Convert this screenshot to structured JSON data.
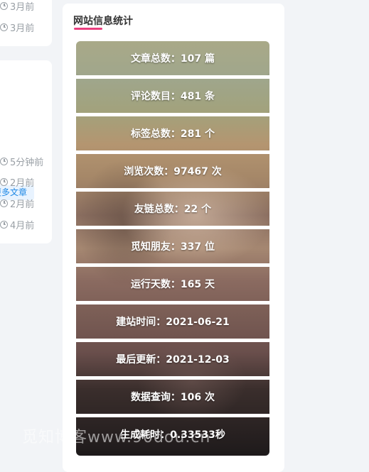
{
  "left_column": {
    "top_card": {
      "times": [
        "3月前",
        "3月前"
      ]
    },
    "middle_card": {
      "more_articles_label": "更多文章",
      "times": [
        "5分钟前",
        "2月前",
        "2月前",
        "4月前"
      ]
    }
  },
  "stats_widget": {
    "title": "网站信息统计",
    "accent_color": "#ea3e7e",
    "items": [
      "文章总数：107 篇",
      "评论数目：481 条",
      "标签总数：281 个",
      "浏览次数：97467 次",
      "友链总数：22 个",
      "觅知朋友：337 位",
      "运行天数：165 天",
      "建站时间：2021-06-21",
      "最后更新：2021-12-03",
      "数据查询：106 次",
      "生成耗时：0.33533秒"
    ]
  },
  "watermark": "觅知博客www.90dou.cn"
}
